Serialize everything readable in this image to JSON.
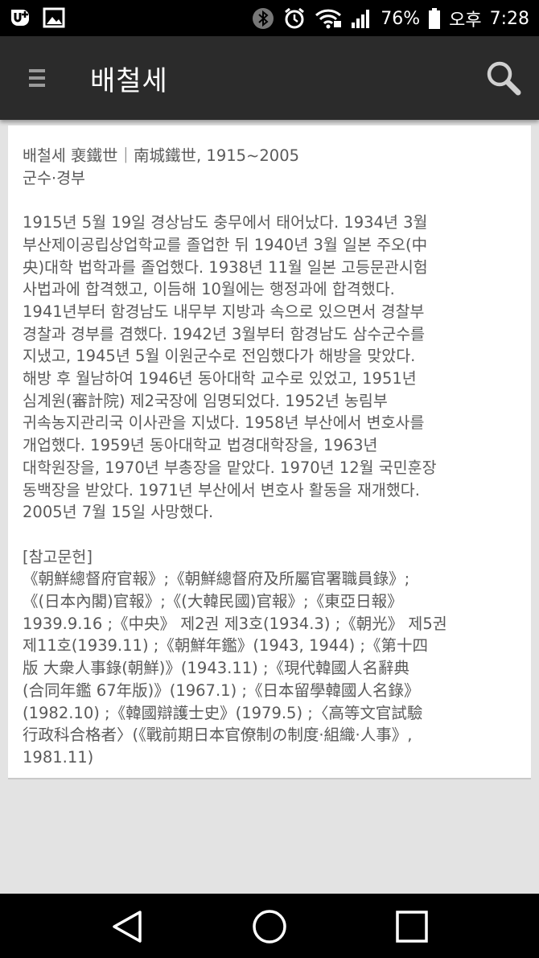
{
  "status_bar": {
    "battery": "76%",
    "ampm": "오후",
    "time": "7:28",
    "icons": [
      "u-plus-icon",
      "gallery-icon",
      "bluetooth-icon",
      "alarm-icon",
      "wifi-icon",
      "signal-icon",
      "battery-icon"
    ]
  },
  "toolbar": {
    "title": "배철세",
    "menu_icon": "hamburger-menu-icon",
    "search_icon": "search-icon"
  },
  "article": {
    "heading_lines": [
      "배철세 裵鐵世｜南城鐵世, 1915~2005",
      "군수·경부"
    ],
    "body_lines": [
      "1915년 5월 19일 경상남도 충무에서 태어났다. 1934년 3월",
      "부산제이공립상업학교를 졸업한 뒤 1940년 3월 일본 주오(中",
      "央)대학 법학과를 졸업했다. 1938년 11월 일본 고등문관시험",
      "사법과에 합격했고, 이듬해 10월에는 행정과에 합격했다.",
      "1941년부터 함경남도 내무부 지방과 속으로 있으면서 경찰부",
      "경찰과 경부를 겸했다. 1942년 3월부터 함경남도 삼수군수를",
      "지냈고, 1945년 5월 이원군수로 전임했다가 해방을 맞았다.",
      "해방 후 월남하여 1946년 동아대학 교수로 있었고, 1951년",
      "심계원(審計院) 제2국장에 임명되었다. 1952년 농림부",
      "귀속농지관리국 이사관을 지냈다. 1958년 부산에서 변호사를",
      "개업했다. 1959년 동아대학교 법경대학장을, 1963년",
      "대학원장을, 1970년 부총장을 맡았다. 1970년 12월 국민훈장",
      "동백장을 받았다. 1971년 부산에서 변호사 활동을 재개했다.",
      "2005년 7월 15일 사망했다."
    ],
    "references_label": "[참고문헌]",
    "reference_lines": [
      "《朝鮮總督府官報》;《朝鮮總督府及所屬官署職員錄》;",
      "《(日本內閣)官報》;《(大韓民國)官報》;《東亞日報》",
      "1939.9.16 ;《中央》 제2권 제3호(1934.3) ;《朝光》 제5권",
      "제11호(1939.11) ;《朝鮮年鑑》(1943, 1944) ;《第十四",
      "版 大衆人事錄(朝鮮)》(1943.11) ;《現代韓國人名辭典",
      "(合同年鑑 67年版)》(1967.1) ;《日本留學韓國人名錄》",
      "(1982.10) ;《韓國辯護士史》(1979.5) ;〈高等文官試驗",
      "行政科合格者〉(《戰前期日本官僚制の制度·組織·人事》,",
      "1981.11)"
    ]
  },
  "nav_bar": {
    "back_icon": "back-triangle-icon",
    "home_icon": "home-circle-icon",
    "recents_icon": "recents-square-icon"
  }
}
